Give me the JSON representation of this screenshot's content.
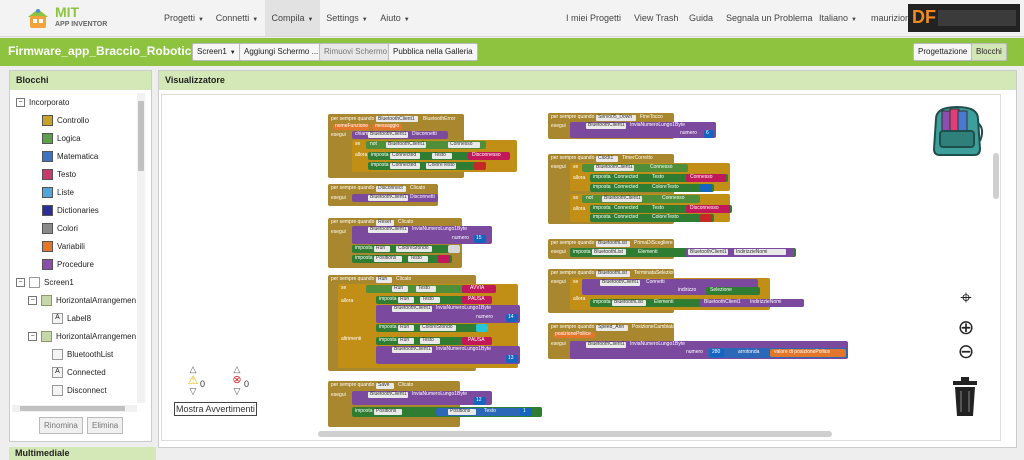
{
  "app": {
    "logo_line1": "MIT",
    "logo_line2": "APP INVENTOR"
  },
  "nav": {
    "left": [
      {
        "label": "Progetti"
      },
      {
        "label": "Connetti"
      },
      {
        "label": "Compila"
      },
      {
        "label": "Settings"
      },
      {
        "label": "Aiuto"
      }
    ],
    "right": [
      {
        "label": "I miei Progetti"
      },
      {
        "label": "View Trash"
      },
      {
        "label": "Guida"
      },
      {
        "label": "Segnala un Problema"
      },
      {
        "label": "Italiano"
      },
      {
        "label": "maurizion"
      }
    ],
    "watermark": "DF"
  },
  "project": {
    "name": "Firmware_app_Braccio_Robotico",
    "screen_select": "Screen1",
    "add_screen": "Aggiungi Schermo ...",
    "remove_screen": "Rimuovi Schermo",
    "publish": "Pubblica nella Galleria",
    "designer": "Progettazione",
    "blocks": "Blocchi"
  },
  "blocks_panel": {
    "title": "Blocchi",
    "builtin": "Incorporato",
    "categories": [
      {
        "label": "Controllo",
        "color": "#c8a228"
      },
      {
        "label": "Logica",
        "color": "#5ca04a"
      },
      {
        "label": "Matematica",
        "color": "#3d73c4"
      },
      {
        "label": "Testo",
        "color": "#c83a6a"
      },
      {
        "label": "Liste",
        "color": "#51a7d9"
      },
      {
        "label": "Dictionaries",
        "color": "#2d2d9a"
      },
      {
        "label": "Colori",
        "color": "#8a8a8a"
      },
      {
        "label": "Variabili",
        "color": "#e2762b"
      },
      {
        "label": "Procedure",
        "color": "#8a50a8"
      }
    ],
    "screen": "Screen1",
    "components": [
      {
        "label": "HorizontalArrangemen"
      },
      {
        "label": "Label8"
      },
      {
        "label": "HorizontalArrangemen"
      },
      {
        "label": "BluetoothList"
      },
      {
        "label": "Connected"
      },
      {
        "label": "Disconnect"
      }
    ],
    "rename": "Rinomina",
    "delete": "Elimina"
  },
  "multimedia": "Multimediale",
  "viewer": {
    "title": "Visualizzatore",
    "warnings_count": "0",
    "errors_count": "0",
    "show_warnings": "Mostra Avvertimenti"
  },
  "blocks": {
    "ev_when": "per sempre quando",
    "do": "esegui",
    "set": "imposta",
    "if": "se",
    "then": "allora",
    "else": "altrimenti",
    "not": "not",
    "call": "chiama",
    "b1": {
      "comp": "BluetoothClient1",
      "event": "BluetoothError",
      "p1": "nomeFunzione",
      "p2": "messaggio",
      "call": "Disconnetti",
      "f1": "Connesso",
      "f2": "Connected",
      "f3": "Testo",
      "f4": "Disconnesso",
      "f5": "ColoreTesto"
    },
    "b2": {
      "comp": "Disconnect",
      "event": "Clicato",
      "call": "Disconnetti"
    },
    "b3": {
      "comp": "Reset",
      "event": "Clicato",
      "call": "InviaNumeroLungo1Byte",
      "arg": "numero",
      "n": "15",
      "f1": "Run",
      "f2": "ColoreSfondo",
      "f3": "Positions",
      "f4": "Testo"
    },
    "b4": {
      "comp": "Run",
      "event": "Clicato",
      "f1": "Testo",
      "s1": "AVVIA",
      "s2": "PAUSA",
      "n1": "14",
      "n2": "13"
    },
    "b5": {
      "comp": "Save",
      "event": "Clicato",
      "n": "12",
      "f1": "Positions",
      "f2": "Testo",
      "n2": "1"
    },
    "b6": {
      "comp": "Servo05_Down",
      "event": "FineTocco",
      "n": "6"
    },
    "b7": {
      "comp": "Clock1",
      "event": "TimerCorretto",
      "s1": "Connesso",
      "s2": "Disconnesso"
    },
    "b8": {
      "comp": "BluetoothList",
      "event": "PrimaDiScegliere",
      "f1": "Elementi",
      "f2": "IndirizzieNomi"
    },
    "b9": {
      "comp": "BluetoothList",
      "event": "TerminataSelezione",
      "f1": "Connetti",
      "f2": "indirizzo",
      "f3": "Selezione"
    },
    "b10": {
      "comp": "Speed_Ann",
      "event": "PosizioneCambiata",
      "p1": "posizionePollice",
      "n": "280",
      "op": "arrotonda",
      "v": "valore di posizionePollice"
    }
  },
  "colors": {
    "green_bar": "#8dc33f",
    "panel_head": "#d4e7b6"
  }
}
